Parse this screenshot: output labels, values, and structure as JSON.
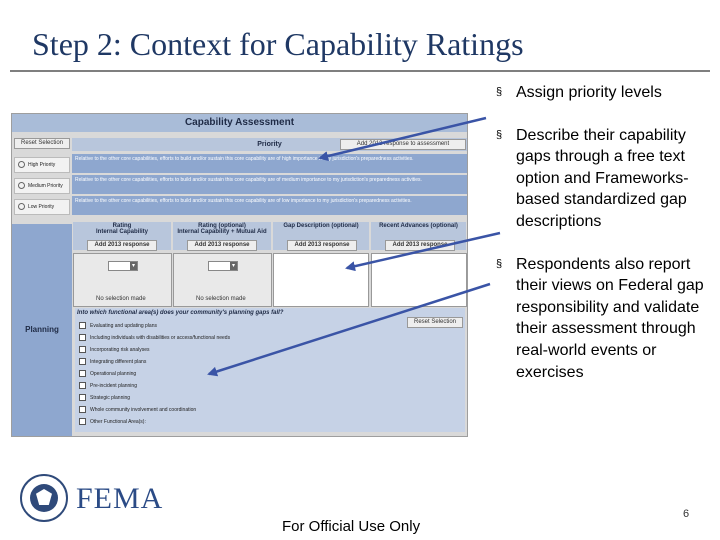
{
  "slide": {
    "title": "Step 2: Context for Capability Ratings",
    "footer": "For Official Use Only",
    "page_number": "6",
    "logo_text": "FEMA",
    "bullet_marker": "§"
  },
  "bullets": [
    "Assign priority levels",
    "Describe their capability gaps through a free text option and Frameworks-based standardized gap descriptions",
    "Respondents also report their views on Federal gap responsibility and validate their assessment through real-world events or exercises"
  ],
  "form": {
    "title": "Capability Assessment",
    "reset_label": "Reset Selection",
    "priority_header": "Priority",
    "add_priority_label": "Add 2013 response to assessment",
    "priority_rows": [
      {
        "label": "High Priority",
        "text": "Relative to the other core capabilities, efforts to build and/or sustain this core capability are of high importance to my jurisdiction's preparedness activities."
      },
      {
        "label": "Medium Priority",
        "text": "Relative to the other core capabilities, efforts to build and/or sustain this core capability are of medium importance to my jurisdiction's preparedness activities."
      },
      {
        "label": "Low Priority",
        "text": "Relative to the other core capabilities, efforts to build and/or sustain this core capability are of low importance to my jurisdiction's preparedness activities."
      }
    ],
    "columns": [
      {
        "title": "Rating",
        "subtitle": "Internal Capability",
        "add": "Add 2013 response"
      },
      {
        "title": "Rating (optional)",
        "subtitle": "Internal Capability + Mutual Aid",
        "add": "Add 2013 response"
      },
      {
        "title": "Gap Description (optional)",
        "subtitle": "",
        "add": "Add 2013 response"
      },
      {
        "title": "Recent Advances (optional)",
        "subtitle": "",
        "add": "Add 2013 response"
      }
    ],
    "no_selection": "No selection made",
    "row_label": "Planning",
    "fa_question": "Into which functional area(s) does your community's planning gaps fall?",
    "fa_reset_label": "Reset Selection",
    "functional_areas": [
      "Evaluating and updating plans",
      "Including individuals with disabilities or access/functional needs",
      "Incorporating risk analyses",
      "Integrating different plans",
      "Operational planning",
      "Pre-incident planning",
      "Strategic planning",
      "Whole community involvement and coordination",
      "Other Functional Area(s):"
    ]
  }
}
